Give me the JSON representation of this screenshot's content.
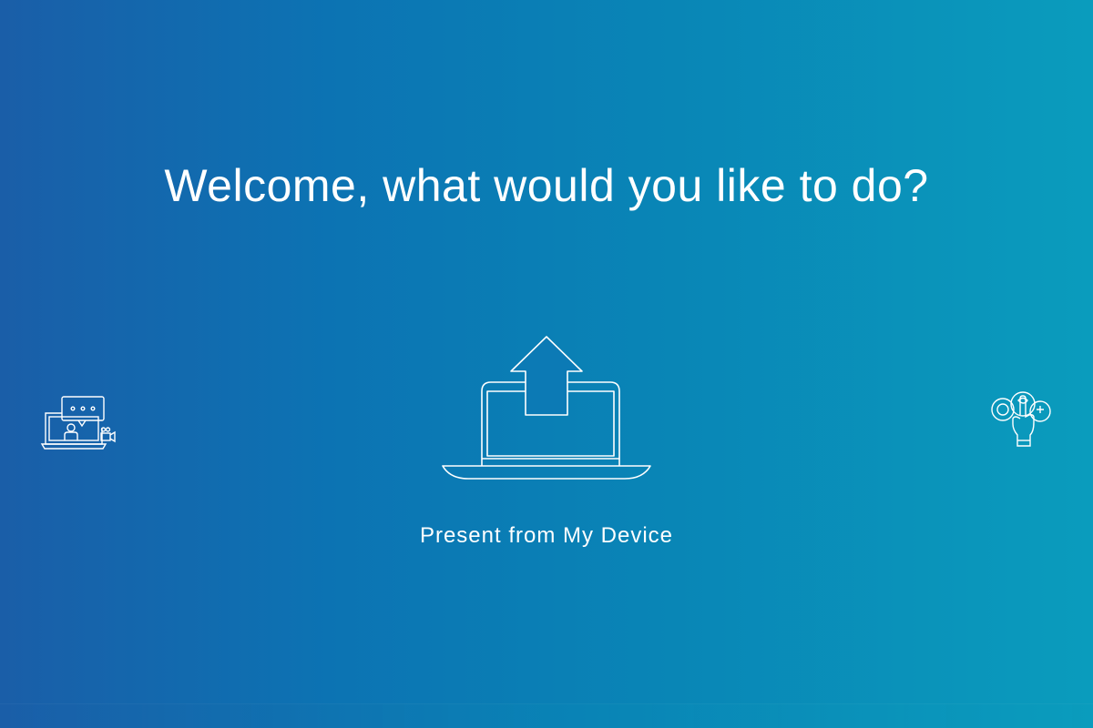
{
  "page": {
    "title": "Welcome, what would you like to do?"
  },
  "options": {
    "left": {
      "icon": "video-meeting-icon"
    },
    "center": {
      "icon": "laptop-upload-icon",
      "label": "Present from My Device"
    },
    "right": {
      "icon": "touch-apps-icon"
    }
  },
  "colors": {
    "gradient_left": "#1a5ea8",
    "gradient_right": "#0a9cbd",
    "foreground": "#ffffff"
  }
}
